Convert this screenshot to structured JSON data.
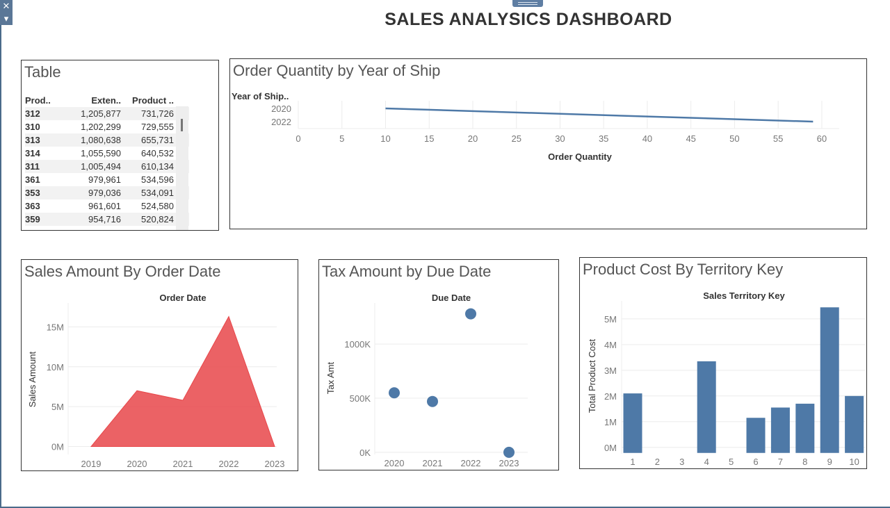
{
  "dashboard": {
    "title": "SALES ANALYSICS DASHBOARD"
  },
  "controls": {
    "close_glyph": "✕",
    "menu_glyph": "▾"
  },
  "colors": {
    "blue": "#4e79a7",
    "red": "#e8474a",
    "frame": "#4a6b8a"
  },
  "table": {
    "title": "Table",
    "headers": [
      "Prod..",
      "Exten..",
      "Product .."
    ],
    "rows": [
      [
        "312",
        "1,205,877",
        "731,726"
      ],
      [
        "310",
        "1,202,299",
        "729,555"
      ],
      [
        "313",
        "1,080,638",
        "655,731"
      ],
      [
        "314",
        "1,055,590",
        "640,532"
      ],
      [
        "311",
        "1,005,494",
        "610,134"
      ],
      [
        "361",
        "979,961",
        "534,596"
      ],
      [
        "353",
        "979,036",
        "534,091"
      ],
      [
        "363",
        "961,601",
        "524,580"
      ],
      [
        "359",
        "954,716",
        "520,824"
      ]
    ]
  },
  "chart_data": [
    {
      "type": "line",
      "title": "Order Quantity by Year of Ship",
      "xlabel": "Order Quantity",
      "ylabel": "Year of Ship..",
      "y_categories": [
        "2020",
        "2022"
      ],
      "xlim": [
        0,
        62
      ],
      "xticks": [
        0,
        5,
        10,
        15,
        20,
        25,
        30,
        35,
        40,
        45,
        50,
        55,
        60
      ],
      "series": [
        {
          "points": [
            {
              "x": 10,
              "y": "2020"
            },
            {
              "x": 59,
              "y": "2022"
            }
          ]
        }
      ],
      "grid": true
    },
    {
      "type": "area",
      "title": "Sales Amount By Order Date",
      "xlabel": "Order Date",
      "ylabel": "Sales Amount",
      "categories": [
        "2019",
        "2020",
        "2021",
        "2022",
        "2023"
      ],
      "values": [
        0,
        7.0,
        5.8,
        16.3,
        0
      ],
      "yticks": [
        "0M",
        "5M",
        "10M",
        "15M"
      ],
      "ylim": [
        -1,
        18
      ],
      "grid": true
    },
    {
      "type": "scatter",
      "title": "Tax Amount by Due Date",
      "xlabel": "Due Date",
      "ylabel": "Tax Amt",
      "categories": [
        "2020",
        "2021",
        "2022",
        "2023"
      ],
      "values": [
        550,
        470,
        1280,
        0
      ],
      "yticks": [
        "0K",
        "500K",
        "1000K"
      ],
      "ylim": [
        -20,
        1380
      ],
      "grid": true
    },
    {
      "type": "bar",
      "title": "Product Cost By Territory Key",
      "xlabel": "Sales Territory Key",
      "ylabel": "Total Product Cost",
      "categories": [
        "1",
        "2",
        "3",
        "4",
        "5",
        "6",
        "7",
        "8",
        "9",
        "10"
      ],
      "values": [
        2.1,
        0,
        0,
        3.35,
        0,
        1.15,
        1.55,
        1.7,
        5.45,
        2.0
      ],
      "yticks": [
        "0M",
        "1M",
        "2M",
        "3M",
        "4M",
        "5M"
      ],
      "ylim": [
        -0.25,
        5.7
      ],
      "grid": true
    }
  ]
}
